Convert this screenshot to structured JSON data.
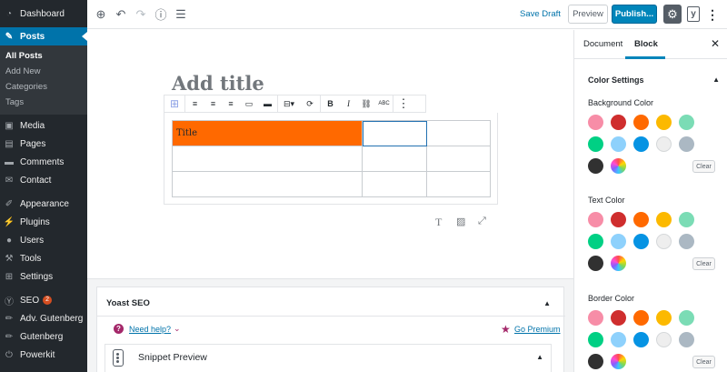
{
  "sidebar": {
    "items": [
      {
        "label": "Dashboard",
        "icon": "dashboard-icon"
      },
      {
        "label": "Posts",
        "icon": "pin-icon"
      },
      {
        "label": "Media",
        "icon": "media-icon"
      },
      {
        "label": "Pages",
        "icon": "pages-icon"
      },
      {
        "label": "Comments",
        "icon": "comments-icon"
      },
      {
        "label": "Contact",
        "icon": "mail-icon"
      },
      {
        "label": "Appearance",
        "icon": "brush-icon"
      },
      {
        "label": "Plugins",
        "icon": "plugin-icon"
      },
      {
        "label": "Users",
        "icon": "user-icon"
      },
      {
        "label": "Tools",
        "icon": "wrench-icon"
      },
      {
        "label": "Settings",
        "icon": "settings-icon"
      },
      {
        "label": "SEO",
        "icon": "yoast-icon",
        "badge": "2"
      },
      {
        "label": "Adv. Gutenberg",
        "icon": "pencil-icon"
      },
      {
        "label": "Gutenberg",
        "icon": "pencil-icon"
      },
      {
        "label": "Powerkit",
        "icon": "power-icon"
      }
    ],
    "posts_sub": [
      "All Posts",
      "Add New",
      "Categories",
      "Tags"
    ]
  },
  "topbar": {
    "save_draft": "Save Draft",
    "preview": "Preview",
    "publish": "Publish...",
    "yoast_letter": "y"
  },
  "editor": {
    "title_placeholder": "Add title",
    "table": {
      "rows": [
        [
          "Title",
          "",
          ""
        ],
        [
          "",
          "",
          ""
        ],
        [
          "",
          "",
          ""
        ]
      ],
      "highlight_color": "#ff6900"
    },
    "toolbar_labels": {
      "bold": "B",
      "italic": "I",
      "strike": "ABC"
    }
  },
  "yoast": {
    "title": "Yoast SEO",
    "help": "Need help?",
    "premium": "Go Premium",
    "snippet": "Snippet Preview"
  },
  "panel": {
    "tabs": {
      "document": "Document",
      "block": "Block"
    },
    "section_title": "Color Settings",
    "groups": [
      {
        "label": "Background Color",
        "clear": "Clear"
      },
      {
        "label": "Text Color",
        "clear": "Clear"
      },
      {
        "label": "Border Color",
        "clear": "Clear"
      }
    ],
    "palette": [
      "#f78da7",
      "#cf2e2e",
      "#ff6900",
      "#fcb900",
      "#7bdcb5",
      "#00d084",
      "#8ed1fc",
      "#0693e3",
      "#eeeeee",
      "#abb8c3",
      "#313131"
    ],
    "accent": "#0085ba"
  }
}
